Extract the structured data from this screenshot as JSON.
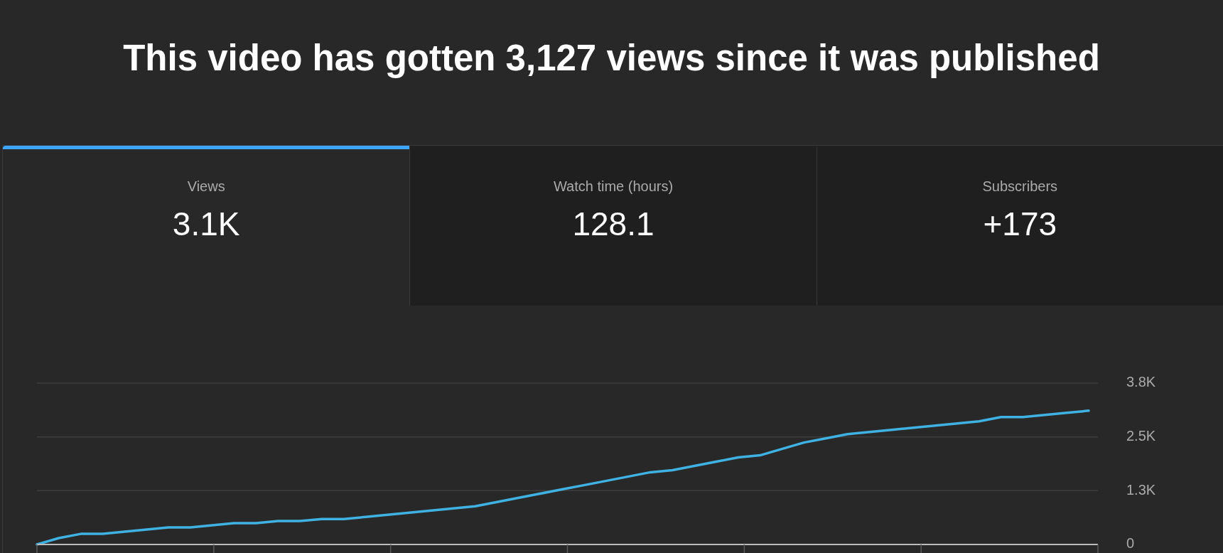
{
  "title": "This video has gotten 3,127 views since it was published",
  "tabs": [
    {
      "label": "Views",
      "value": "3.1K",
      "selected": true
    },
    {
      "label": "Watch time (hours)",
      "value": "128.1",
      "selected": false
    },
    {
      "label": "Subscribers",
      "value": "+173",
      "selected": false
    }
  ],
  "chart": {
    "chart_data": {
      "type": "line",
      "categories": [
        null,
        null,
        null,
        null,
        null,
        null,
        null,
        null,
        null,
        null,
        null,
        null,
        null,
        null,
        null,
        null,
        null,
        null,
        null,
        null,
        null,
        null,
        null,
        null,
        null,
        null,
        null,
        null,
        null,
        null,
        null,
        null,
        null,
        null,
        null,
        null,
        null,
        null,
        null,
        null,
        null,
        null,
        null,
        null,
        null,
        null,
        null,
        null,
        null
      ],
      "values": [
        0,
        150,
        250,
        250,
        300,
        350,
        400,
        400,
        450,
        500,
        500,
        550,
        550,
        600,
        600,
        650,
        700,
        750,
        800,
        850,
        900,
        1000,
        1100,
        1200,
        1300,
        1400,
        1500,
        1600,
        1700,
        1750,
        1850,
        1950,
        2050,
        2100,
        2250,
        2400,
        2500,
        2600,
        2650,
        2700,
        2750,
        2800,
        2850,
        2900,
        3000,
        3000,
        3050,
        3100,
        3150
      ],
      "ylim": [
        0,
        3800
      ],
      "yticks": [
        {
          "value": 0,
          "label": "0"
        },
        {
          "value": 1267,
          "label": "1.3K"
        },
        {
          "value": 2533,
          "label": "2.5K"
        },
        {
          "value": 3800,
          "label": "3.8K"
        }
      ]
    }
  }
}
